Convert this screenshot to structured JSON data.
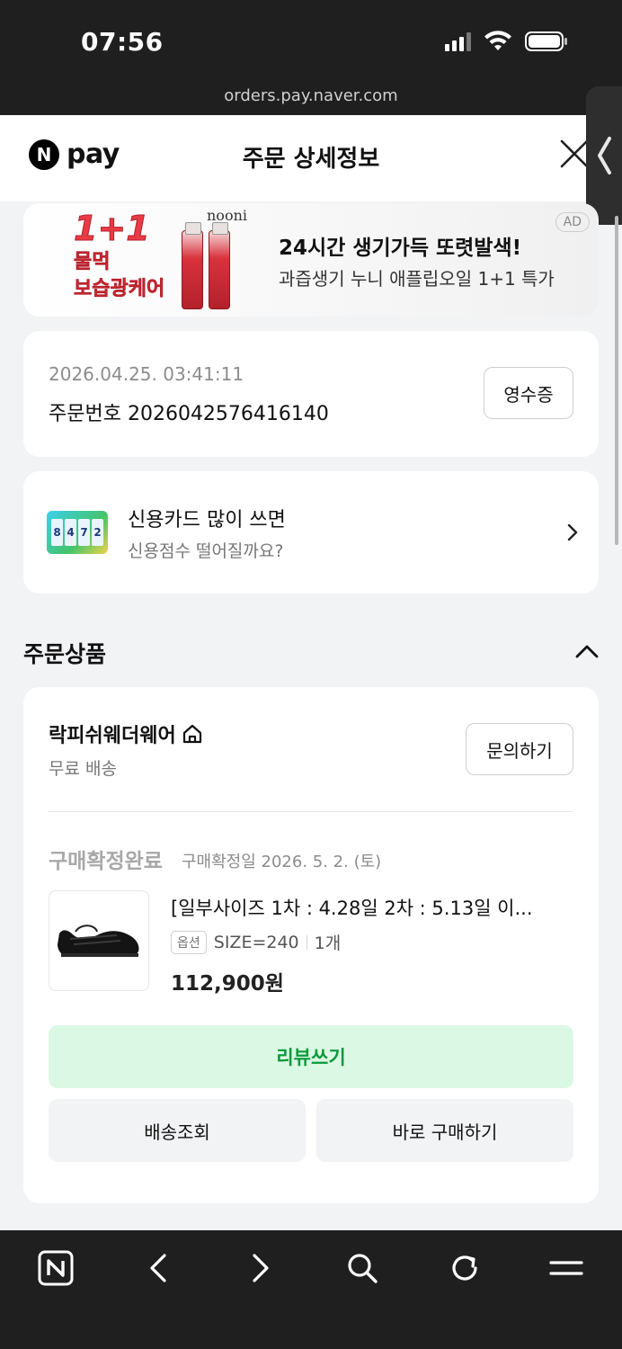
{
  "status_bar": {
    "time": "07:56"
  },
  "browser": {
    "url": "orders.pay.naver.com"
  },
  "header": {
    "logo_n": "N",
    "logo_text": "pay",
    "title": "주문 상세정보"
  },
  "ad": {
    "promo_big": "1+1",
    "promo_line1": "물먹",
    "promo_line2": "보습광케어",
    "brand": "nooni",
    "title": "24시간 생기가득 또렷발색!",
    "subtitle": "과즙생기 누니 애플립오일 1+1 특가",
    "badge": "AD"
  },
  "order": {
    "datetime": "2026.04.25. 03:41:11",
    "order_number": "주문번호 2026042576416140",
    "receipt_label": "영수증"
  },
  "credit_promo": {
    "title": "신용카드 많이 쓰면",
    "subtitle": "신용점수 떨어질까요?",
    "icon_digits": [
      "8",
      "4",
      "7",
      "2"
    ]
  },
  "section": {
    "title": "주문상품"
  },
  "product_card": {
    "store_name": "락피쉬웨더웨어",
    "shipping": "무료 배송",
    "inquiry_label": "문의하기",
    "status": "구매확정완료",
    "confirm_date": "구매확정일 2026. 5. 2. (토)",
    "product_name": "[일부사이즈 1차 : 4.28일 2차 : 5.13일 이...",
    "option_badge": "옵션",
    "option_value": "SIZE=240",
    "quantity": "1개",
    "price": "112,900원",
    "review_label": "리뷰쓰기",
    "tracking_label": "배송조회",
    "buy_again_label": "바로 구매하기"
  },
  "colors": {
    "accent_green": "#0a9a3a",
    "review_bg": "#dbf8e4",
    "ad_red": "#e83b46"
  },
  "bottom_bar_icons": [
    "naver-n-icon",
    "back-icon",
    "forward-icon",
    "search-icon",
    "refresh-icon",
    "menu-icon"
  ]
}
